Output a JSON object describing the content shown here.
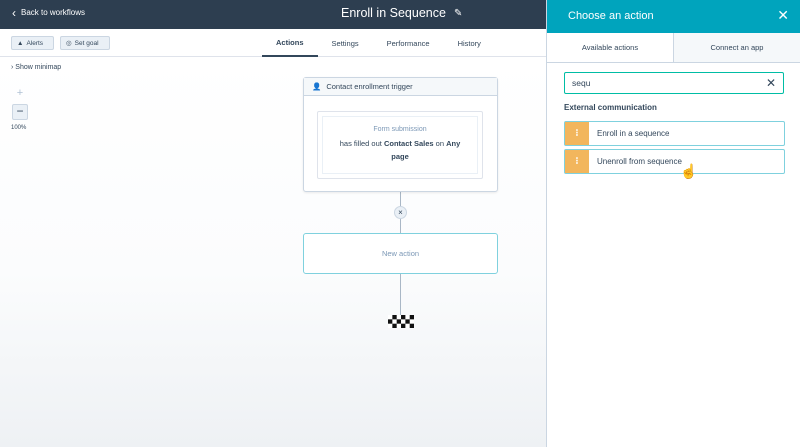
{
  "topbar": {
    "back_label": "Back to workflows",
    "workflow_title": "Enroll in Sequence"
  },
  "toolbar": {
    "alerts_label": "Alerts",
    "goal_label": "Set goal"
  },
  "nav": {
    "tabs": [
      {
        "label": "Actions",
        "active": true
      },
      {
        "label": "Settings",
        "active": false
      },
      {
        "label": "Performance",
        "active": false
      },
      {
        "label": "History",
        "active": false
      }
    ]
  },
  "canvas": {
    "minimap_label": "Show minimap",
    "zoom_in": "+",
    "zoom_out": "−",
    "zoom_level": "100%",
    "trigger": {
      "header": "Contact enrollment trigger",
      "type": "Form submission",
      "text_prefix": "has filled out",
      "form_name": "Contact Sales",
      "text_mid": "on",
      "page": "Any page"
    },
    "new_action_label": "New action"
  },
  "panel": {
    "title": "Choose an action",
    "tabs": [
      {
        "label": "Available actions",
        "active": true
      },
      {
        "label": "Connect an app",
        "active": false
      }
    ],
    "search": {
      "value": "sequ",
      "placeholder": "Search actions"
    },
    "section_title": "External communication",
    "actions": [
      {
        "label": "Enroll in a sequence"
      },
      {
        "label": "Unenroll from sequence"
      }
    ]
  },
  "colors": {
    "topbar": "#2d3e50",
    "panel_header": "#00a4bd",
    "action_icon": "#f2b65d",
    "search_focus": "#00bda5"
  }
}
